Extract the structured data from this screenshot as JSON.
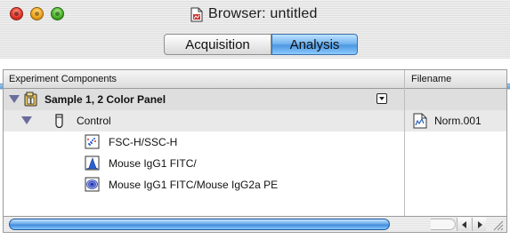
{
  "window": {
    "title": "Browser: untitled"
  },
  "tabs": [
    {
      "label": "Acquisition",
      "active": false
    },
    {
      "label": "Analysis",
      "active": true
    }
  ],
  "table": {
    "columns": [
      "Experiment Components",
      "Filename"
    ],
    "rows": [
      {
        "label": "Sample 1, 2 Color Panel",
        "icon": "sample-folder-icon",
        "expanded": true,
        "filename": ""
      },
      {
        "label": "Control",
        "icon": "tube-icon",
        "expanded": true,
        "filename": "Norm.001"
      },
      {
        "label": "FSC-H/SSC-H",
        "icon": "dot-plot-icon",
        "filename": ""
      },
      {
        "label": "Mouse IgG1 FITC/",
        "icon": "histogram-icon",
        "filename": ""
      },
      {
        "label": "Mouse IgG1 FITC/Mouse IgG2a PE",
        "icon": "contour-plot-icon",
        "filename": ""
      }
    ]
  },
  "colors": {
    "accent": "#5a9fe4",
    "selection_row": "#dedede"
  }
}
